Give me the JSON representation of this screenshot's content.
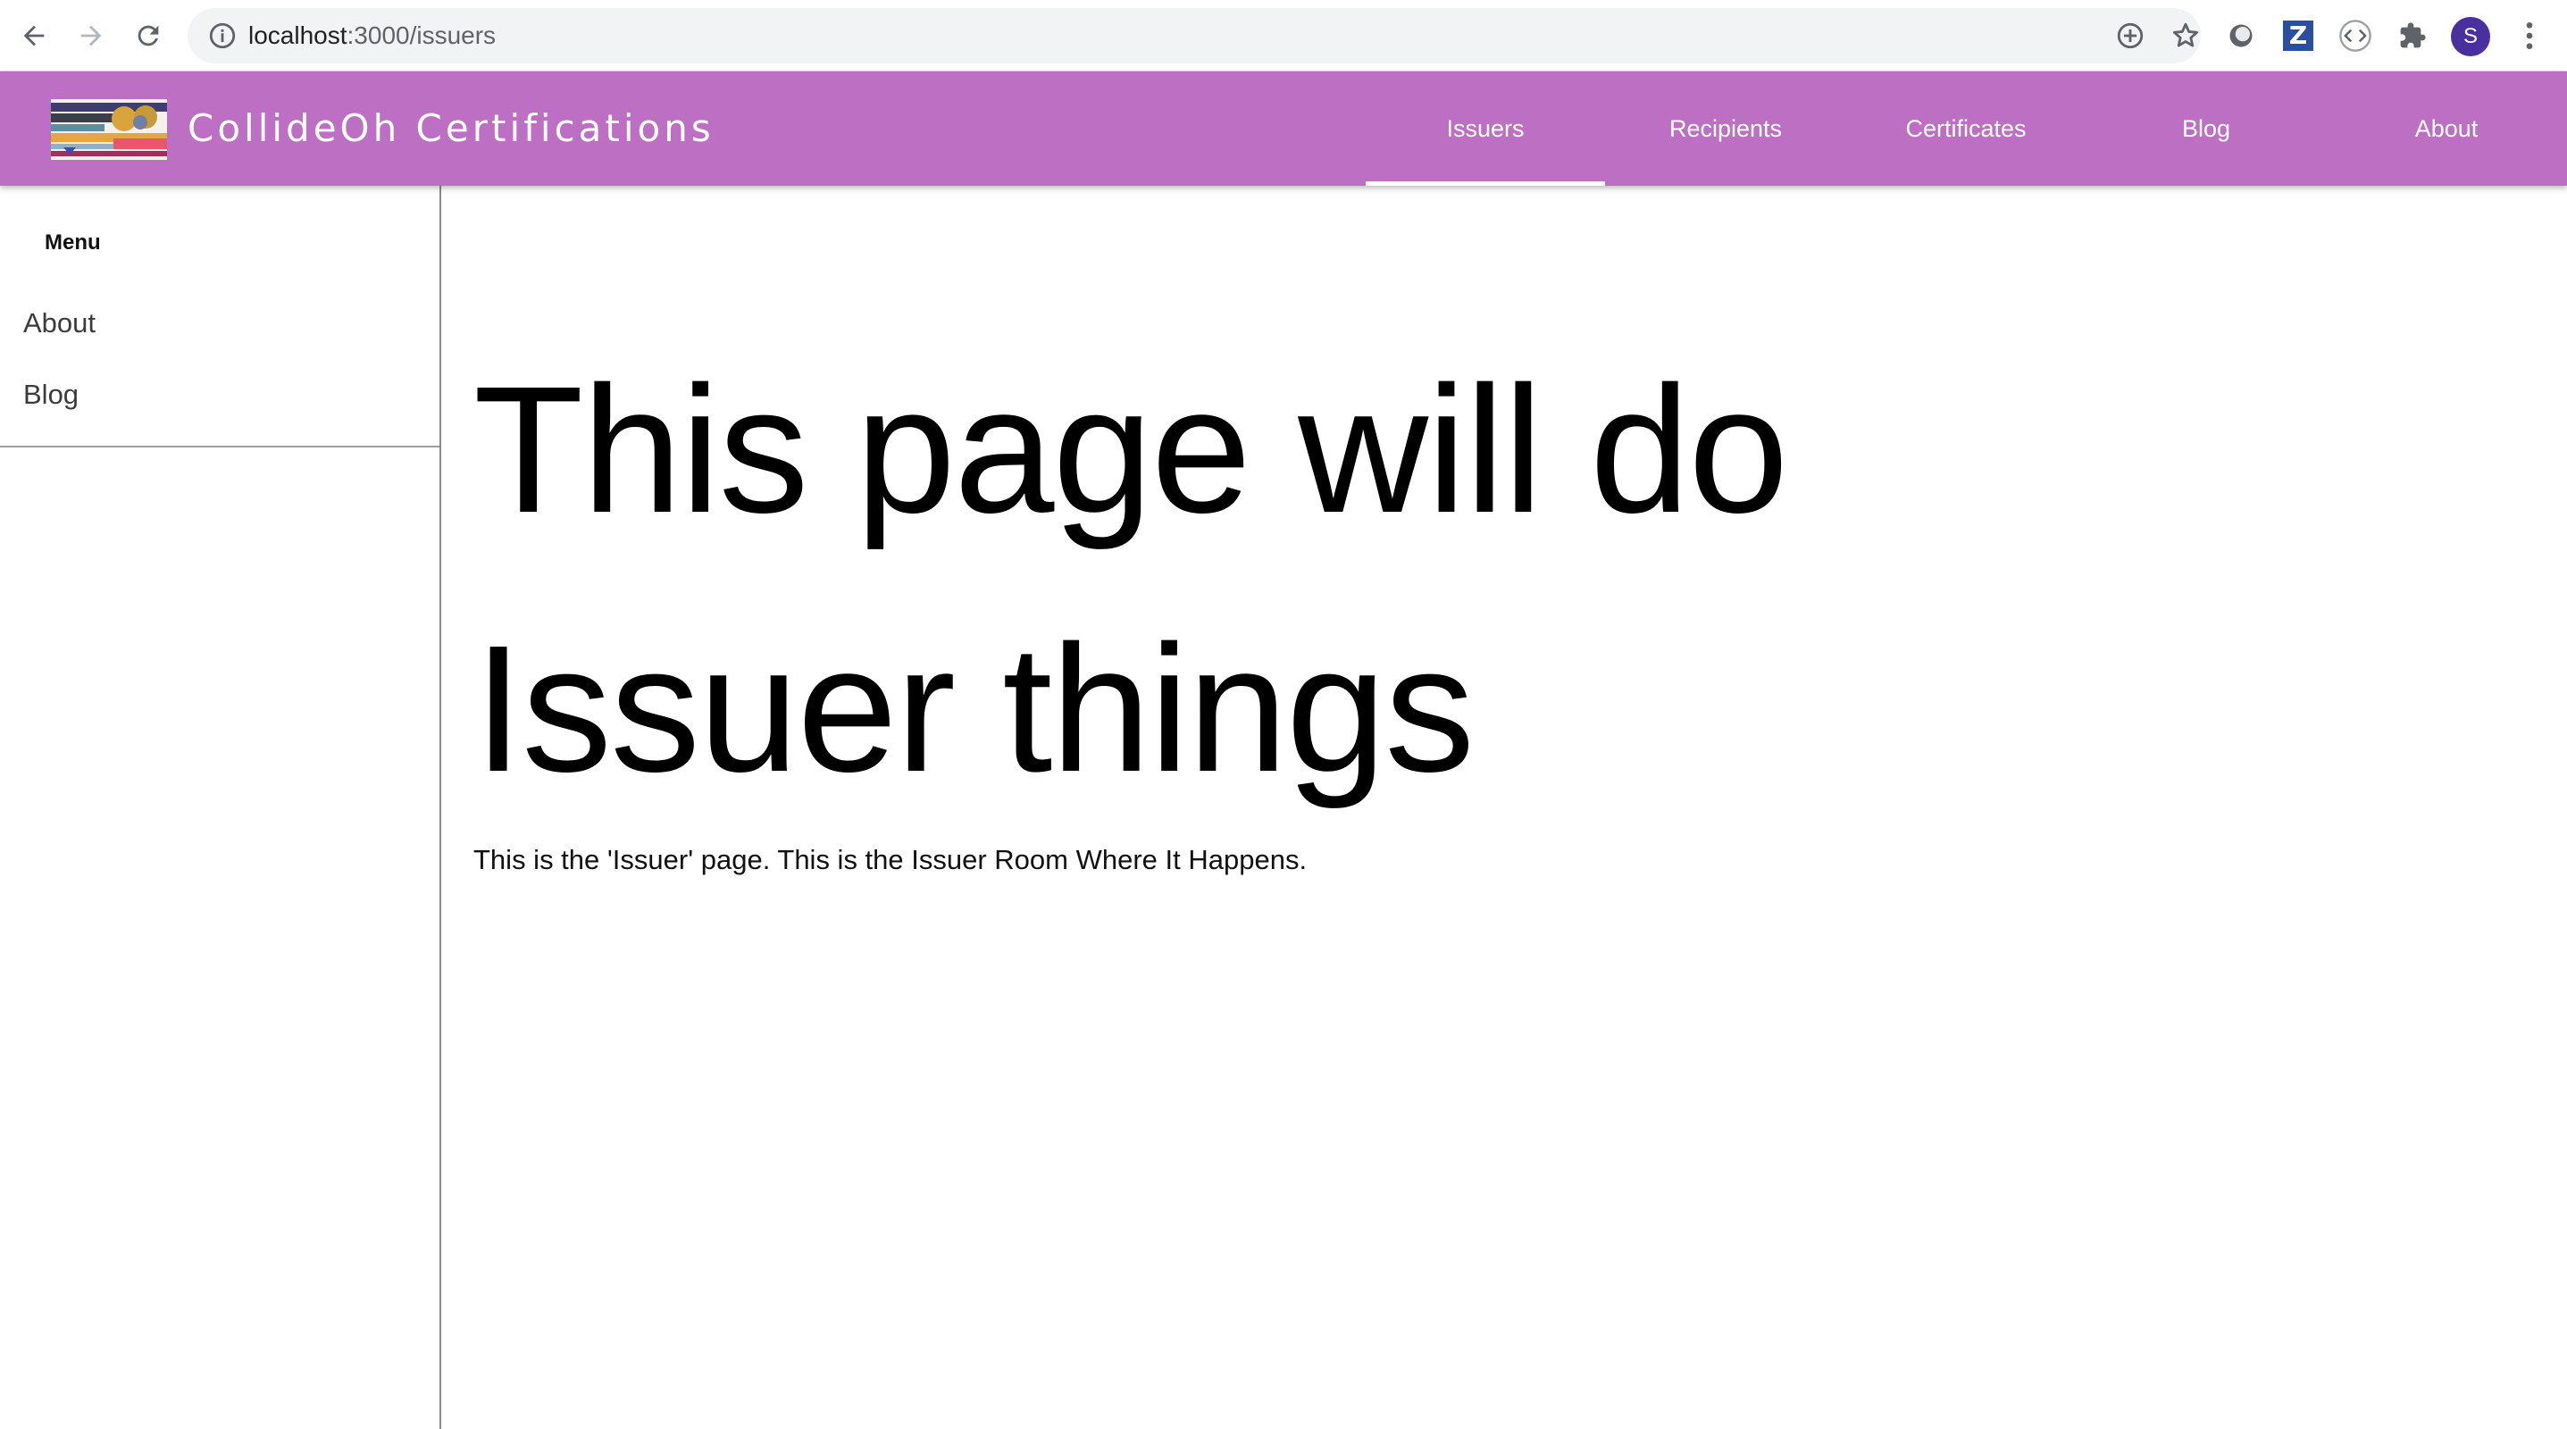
{
  "browser": {
    "url_host": "localhost",
    "url_path": ":3000/issuers",
    "profile_initial": "S",
    "extension_letter": "Z"
  },
  "app": {
    "title": "CollideOh Certifications",
    "brand_color": "#bc6fc3",
    "nav": [
      {
        "label": "Issuers",
        "active": true
      },
      {
        "label": "Recipients",
        "active": false
      },
      {
        "label": "Certificates",
        "active": false
      },
      {
        "label": "Blog",
        "active": false
      },
      {
        "label": "About",
        "active": false
      }
    ]
  },
  "sidebar": {
    "title": "Menu",
    "items": [
      {
        "label": "About"
      },
      {
        "label": "Blog"
      }
    ]
  },
  "main": {
    "heading_line1": "This page will do",
    "heading_line2": "Issuer things",
    "body": "This is the 'Issuer' page. This is the Issuer Room Where It Happens."
  }
}
